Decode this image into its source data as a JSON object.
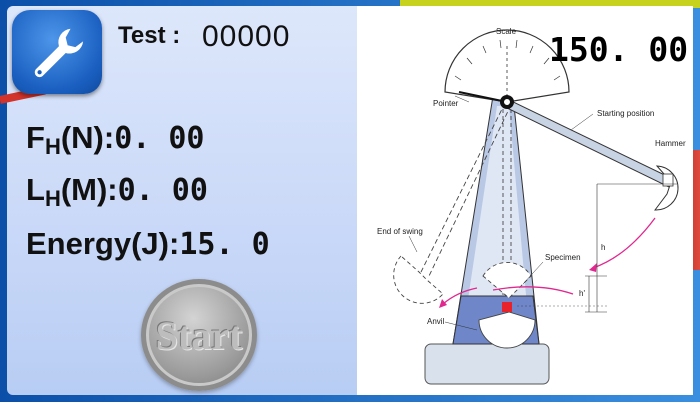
{
  "app": {
    "test_label": "Test :",
    "test_value": "00000",
    "reading": "150. 00"
  },
  "readouts": [
    {
      "label_main": "F",
      "label_sub": "H",
      "label_unit": "(N):",
      "value": "0. 00"
    },
    {
      "label_main": "L",
      "label_sub": "H",
      "label_unit": "(M):",
      "value": "0. 00"
    },
    {
      "label_main": "Energy",
      "label_sub": "",
      "label_unit": "(J):",
      "value": "15. 0"
    }
  ],
  "buttons": {
    "start_label": "Start",
    "settings_icon": "wrench-icon"
  },
  "diagram": {
    "labels": {
      "scale": "Scale",
      "pointer": "Pointer",
      "starting_position": "Starting position",
      "hammer": "Hammer",
      "end_of_swing": "End of swing",
      "specimen": "Specimen",
      "anvil": "Anvil",
      "h": "h",
      "h_prime": "h'"
    }
  },
  "colors": {
    "frame_blue": "#1d6cc6",
    "panel_light": "#cad9f8",
    "accent_yellow": "#c7d21f",
    "accent_red": "#d2332a",
    "specimen_red": "#e8222a",
    "swing_arrow": "#e0288f"
  }
}
